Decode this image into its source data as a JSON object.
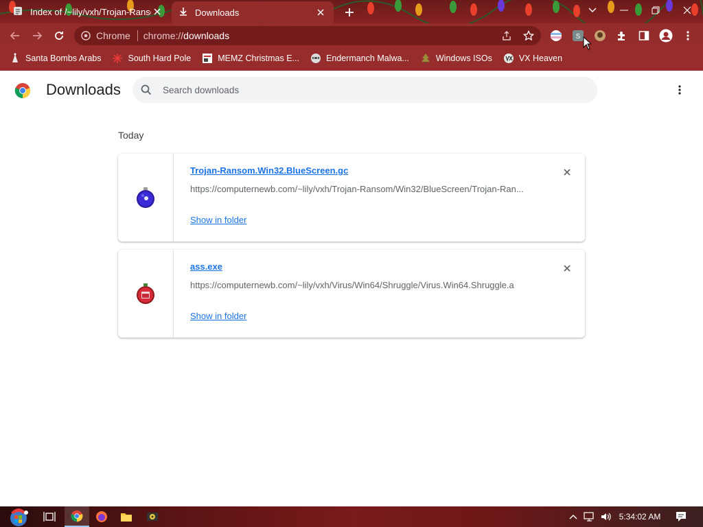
{
  "tabs": [
    {
      "title": "Index of /~lily/vxh/Trojan-Ransom",
      "active": false
    },
    {
      "title": "Downloads",
      "active": true
    }
  ],
  "omnibox": {
    "chip": "Chrome",
    "url_scheme": "chrome://",
    "url_host": "downloads"
  },
  "bookmarks": [
    {
      "label": "Santa Bombs Arabs",
      "icon": "santa-icon"
    },
    {
      "label": "South Hard Pole",
      "icon": "snowflake-icon"
    },
    {
      "label": "MEMZ Christmas E...",
      "icon": "page-icon"
    },
    {
      "label": "Endermanch Malwa...",
      "icon": "raccoon-icon"
    },
    {
      "label": "Windows ISOs",
      "icon": "tree-icon"
    },
    {
      "label": "VX Heaven",
      "icon": "vx-icon"
    }
  ],
  "page": {
    "title": "Downloads",
    "search_placeholder": "Search downloads",
    "section_date": "Today"
  },
  "downloads": [
    {
      "filename": "Trojan-Ransom.Win32.BlueScreen.gc",
      "url": "https://computernewb.com/~lily/vxh/Trojan-Ransom/Win32/BlueScreen/Trojan-Ran...",
      "action": "Show in folder",
      "icon": "blue-ornament-icon"
    },
    {
      "filename": "ass.exe",
      "url": "https://computernewb.com/~lily/vxh/Virus/Win64/Shruggle/Virus.Win64.Shruggle.a",
      "action": "Show in folder",
      "icon": "red-ornament-icon"
    }
  ],
  "taskbar": {
    "clock": "5:34:02 AM"
  },
  "colors": {
    "chrome_bg": "#9c2a2a",
    "link": "#1a73e8",
    "text": "#202124"
  }
}
